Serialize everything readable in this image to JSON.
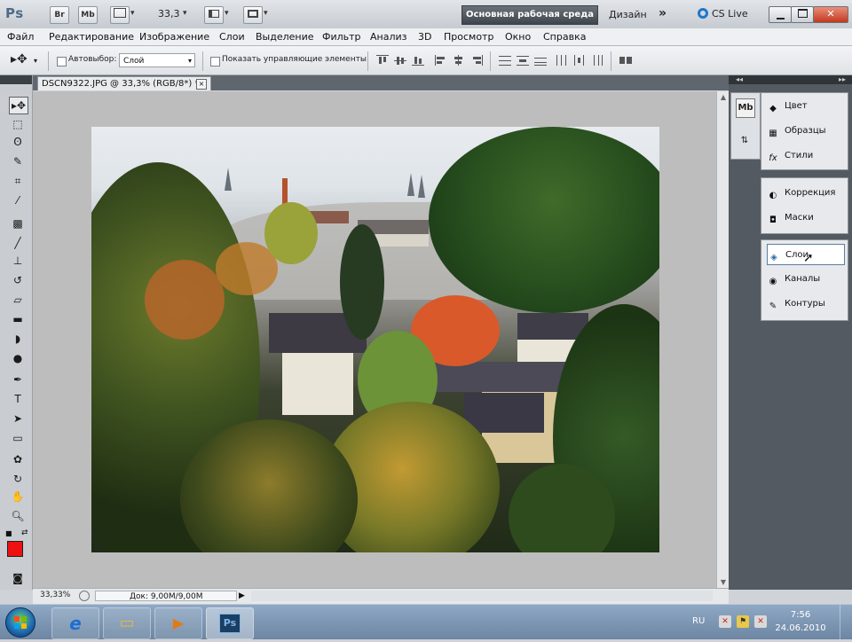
{
  "app": {
    "logo": "Ps",
    "bridge_label": "Br",
    "minibridge_label": "Mb",
    "zoom_value": "33,3",
    "workspace_label": "Основная рабочая среда",
    "design_label": "Дизайн",
    "more_label": "»",
    "cslive_label": "CS Live",
    "dropdown_glyph": "▾"
  },
  "menu": [
    "Файл",
    "Редактирование",
    "Изображение",
    "Слои",
    "Выделение",
    "Фильтр",
    "Анализ",
    "3D",
    "Просмотр",
    "Окно",
    "Справка"
  ],
  "options": {
    "autoselect_label": "Автовыбор:",
    "autoselect_value": "Слой",
    "show_transform_label": "Показать управляющие элементы"
  },
  "document": {
    "tab_title": "DSCN9322.JPG @ 33,3% (RGB/8*) *",
    "close_glyph": "×"
  },
  "status": {
    "zoom": "33,33%",
    "doc_info": "Док: 9,00M/9,00M",
    "arrow": "▶"
  },
  "panels": {
    "strip_icons": [
      "Mb",
      "⇅"
    ],
    "group1": [
      {
        "label": "Цвет",
        "icon": "color-palette-icon",
        "glyph": "◆"
      },
      {
        "label": "Образцы",
        "icon": "swatches-icon",
        "glyph": "▦"
      },
      {
        "label": "Стили",
        "icon": "styles-icon",
        "glyph": "fx"
      }
    ],
    "group2": [
      {
        "label": "Коррекция",
        "icon": "adjustments-icon",
        "glyph": "◐"
      },
      {
        "label": "Маски",
        "icon": "masks-icon",
        "glyph": "◘"
      }
    ],
    "group3": [
      {
        "label": "Слои",
        "icon": "layers-icon",
        "glyph": "◈"
      },
      {
        "label": "Каналы",
        "icon": "channels-icon",
        "glyph": "◉"
      },
      {
        "label": "Контуры",
        "icon": "paths-icon",
        "glyph": "✎"
      }
    ]
  },
  "taskbar": {
    "apps": [
      {
        "name": "internet-explorer",
        "glyph": "e",
        "color": "#1d6fd0"
      },
      {
        "name": "file-explorer",
        "glyph": "▭",
        "color": "#e6b83a"
      },
      {
        "name": "media-player",
        "glyph": "▶",
        "color": "#e27a14"
      },
      {
        "name": "photoshop",
        "glyph": "Ps",
        "color": "#2b78c8"
      }
    ],
    "lang": "RU",
    "time": "7:56",
    "date": "24.06.2010"
  },
  "colors": {
    "foreground": "#ee1111",
    "background": "#ffffff",
    "accent": "#1d78c9"
  }
}
